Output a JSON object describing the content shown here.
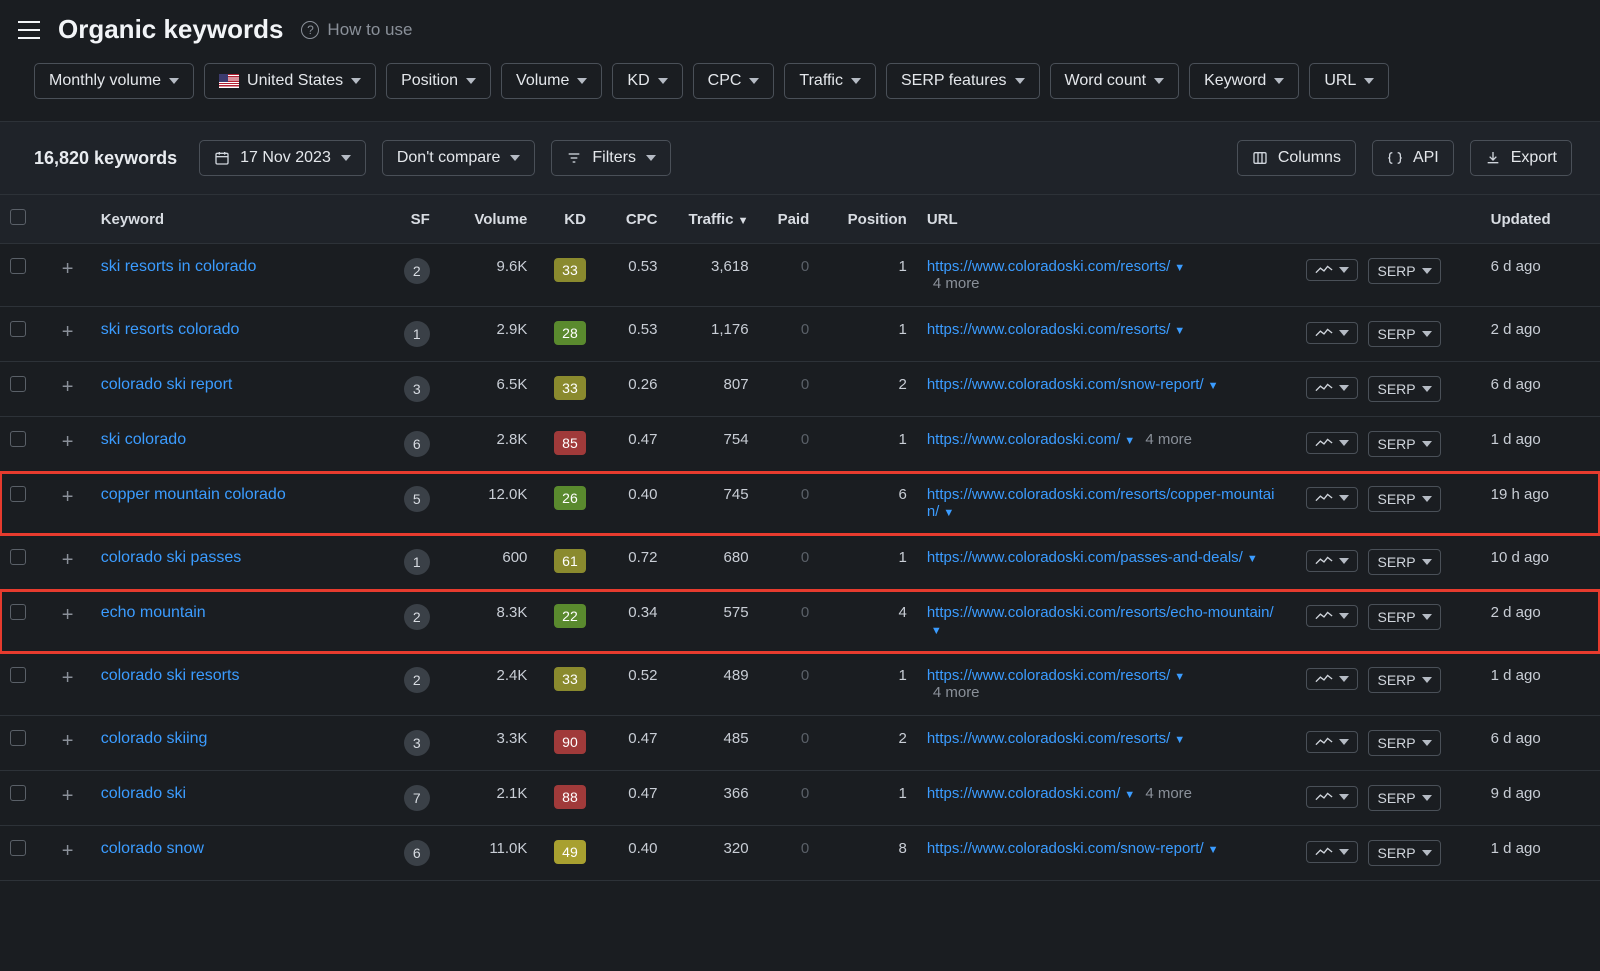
{
  "header": {
    "title": "Organic keywords",
    "how_to": "How to use",
    "how_icon": "?"
  },
  "filters": {
    "monthly_volume": "Monthly volume",
    "country": "United States",
    "position": "Position",
    "volume": "Volume",
    "kd": "KD",
    "cpc": "CPC",
    "traffic": "Traffic",
    "serp_features": "SERP features",
    "word_count": "Word count",
    "keyword": "Keyword",
    "url": "URL"
  },
  "toolbar": {
    "count": "16,820 keywords",
    "date": "17 Nov 2023",
    "compare": "Don't compare",
    "filters": "Filters",
    "columns": "Columns",
    "api": "API",
    "export": "Export"
  },
  "columns": {
    "keyword": "Keyword",
    "sf": "SF",
    "volume": "Volume",
    "kd": "KD",
    "cpc": "CPC",
    "traffic": "Traffic",
    "paid": "Paid",
    "position": "Position",
    "url": "URL",
    "updated": "Updated"
  },
  "serp_btn": "SERP",
  "rows": [
    {
      "kw": "ski resorts in colorado",
      "sf": "2",
      "vol": "9.6K",
      "kd": "33",
      "kdClass": "kd-olive",
      "cpc": "0.53",
      "traffic": "3,618",
      "paid": "0",
      "pos": "1",
      "url": "https://www.coloradoski.com/resorts/",
      "more": "4 more",
      "updated": "6 d ago",
      "hl": false,
      "moreInline": false
    },
    {
      "kw": "ski resorts colorado",
      "sf": "1",
      "vol": "2.9K",
      "kd": "28",
      "kdClass": "kd-green",
      "cpc": "0.53",
      "traffic": "1,176",
      "paid": "0",
      "pos": "1",
      "url": "https://www.coloradoski.com/resorts/",
      "more": "",
      "updated": "2 d ago",
      "hl": false,
      "moreInline": false
    },
    {
      "kw": "colorado ski report",
      "sf": "3",
      "vol": "6.5K",
      "kd": "33",
      "kdClass": "kd-olive",
      "cpc": "0.26",
      "traffic": "807",
      "paid": "0",
      "pos": "2",
      "url": "https://www.coloradoski.com/snow-report/",
      "more": "",
      "updated": "6 d ago",
      "hl": false,
      "moreInline": false
    },
    {
      "kw": "ski colorado",
      "sf": "6",
      "vol": "2.8K",
      "kd": "85",
      "kdClass": "kd-red",
      "cpc": "0.47",
      "traffic": "754",
      "paid": "0",
      "pos": "1",
      "url": "https://www.coloradoski.com/",
      "more": "4 more",
      "updated": "1 d ago",
      "hl": false,
      "moreInline": true
    },
    {
      "kw": "copper mountain colorado",
      "sf": "5",
      "vol": "12.0K",
      "kd": "26",
      "kdClass": "kd-green",
      "cpc": "0.40",
      "traffic": "745",
      "paid": "0",
      "pos": "6",
      "url": "https://www.coloradoski.com/resorts/copper-mountain/",
      "more": "",
      "updated": "19 h ago",
      "hl": true,
      "moreInline": false
    },
    {
      "kw": "colorado ski passes",
      "sf": "1",
      "vol": "600",
      "kd": "61",
      "kdClass": "kd-olive",
      "cpc": "0.72",
      "traffic": "680",
      "paid": "0",
      "pos": "1",
      "url": "https://www.coloradoski.com/passes-and-deals/",
      "more": "",
      "updated": "10 d ago",
      "hl": false,
      "moreInline": false
    },
    {
      "kw": "echo mountain",
      "sf": "2",
      "vol": "8.3K",
      "kd": "22",
      "kdClass": "kd-green",
      "cpc": "0.34",
      "traffic": "575",
      "paid": "0",
      "pos": "4",
      "url": "https://www.coloradoski.com/resorts/echo-mountain/",
      "more": "",
      "updated": "2 d ago",
      "hl": true,
      "moreInline": false
    },
    {
      "kw": "colorado ski resorts",
      "sf": "2",
      "vol": "2.4K",
      "kd": "33",
      "kdClass": "kd-olive",
      "cpc": "0.52",
      "traffic": "489",
      "paid": "0",
      "pos": "1",
      "url": "https://www.coloradoski.com/resorts/",
      "more": "4 more",
      "updated": "1 d ago",
      "hl": false,
      "moreInline": false
    },
    {
      "kw": "colorado skiing",
      "sf": "3",
      "vol": "3.3K",
      "kd": "90",
      "kdClass": "kd-red",
      "cpc": "0.47",
      "traffic": "485",
      "paid": "0",
      "pos": "2",
      "url": "https://www.coloradoski.com/resorts/",
      "more": "",
      "updated": "6 d ago",
      "hl": false,
      "moreInline": false
    },
    {
      "kw": "colorado ski",
      "sf": "7",
      "vol": "2.1K",
      "kd": "88",
      "kdClass": "kd-red",
      "cpc": "0.47",
      "traffic": "366",
      "paid": "0",
      "pos": "1",
      "url": "https://www.coloradoski.com/",
      "more": "4 more",
      "updated": "9 d ago",
      "hl": false,
      "moreInline": true
    },
    {
      "kw": "colorado snow",
      "sf": "6",
      "vol": "11.0K",
      "kd": "49",
      "kdClass": "kd-yellow",
      "cpc": "0.40",
      "traffic": "320",
      "paid": "0",
      "pos": "8",
      "url": "https://www.coloradoski.com/snow-report/",
      "more": "",
      "updated": "1 d ago",
      "hl": false,
      "moreInline": false
    }
  ]
}
